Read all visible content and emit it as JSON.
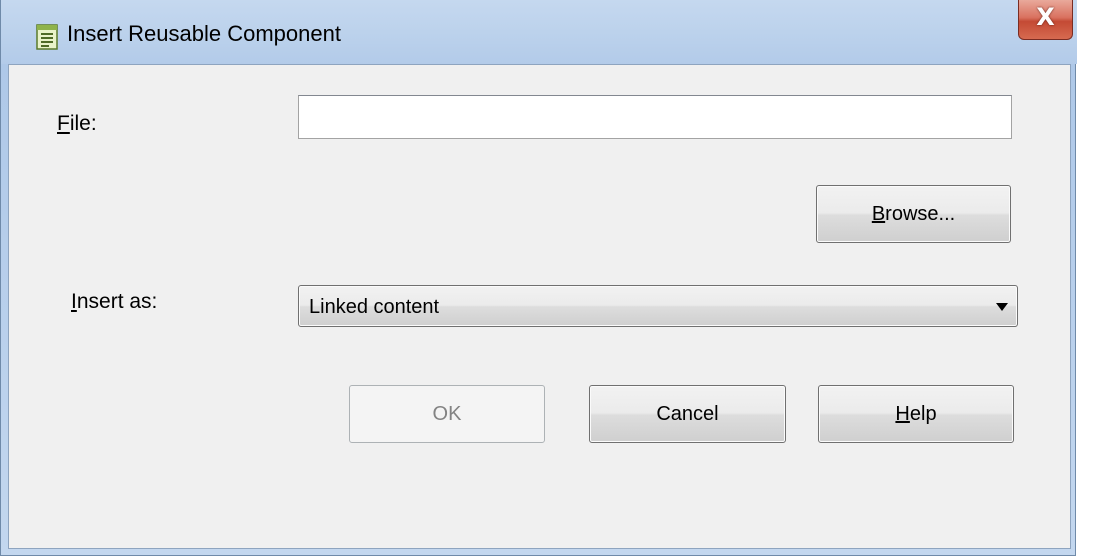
{
  "window": {
    "title": "Insert Reusable Component",
    "close_label": "X"
  },
  "form": {
    "file_label": "File:",
    "file_value": "",
    "browse_label": "Browse...",
    "insert_as_label": "Insert as:",
    "insert_as_selected": "Linked content"
  },
  "buttons": {
    "ok": "OK",
    "cancel": "Cancel",
    "help": "Help"
  },
  "colors": {
    "titlebar": "#bcd2ec",
    "dialog_bg": "#f0f0f0",
    "close_button": "#c44a34",
    "disabled_text": "#838383"
  }
}
